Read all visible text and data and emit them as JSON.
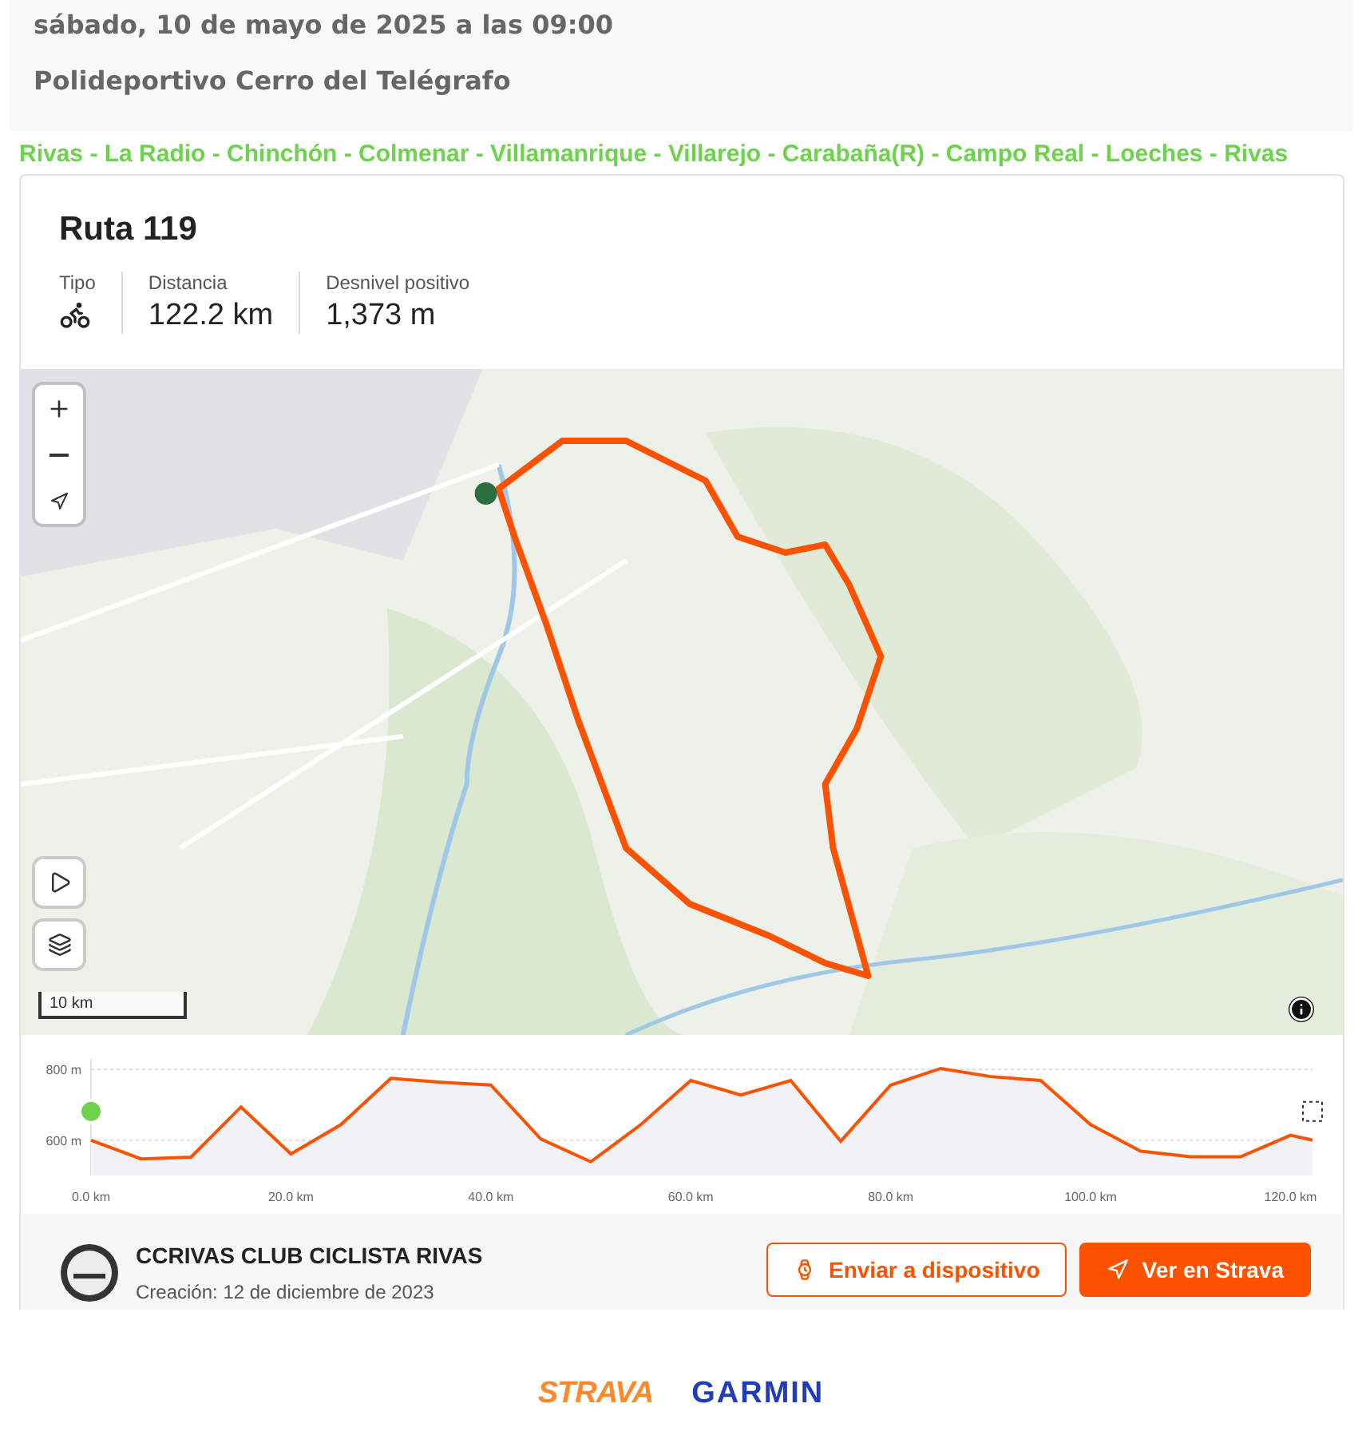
{
  "event": {
    "date": "sábado, 10 de mayo de 2025 a las 09:00",
    "place": "Polideportivo Cerro del Telégrafo"
  },
  "route_line": "Rivas - La Radio - Chinchón - Colmenar - Villamanrique - Villarejo - Carabaña(R) - Campo Real - Loeches - Rivas",
  "route": {
    "title": "Ruta 119",
    "stats": [
      {
        "kind": "icon",
        "label": "Tipo"
      },
      {
        "kind": "text",
        "label": "Distancia",
        "value": "122.2 km"
      },
      {
        "kind": "text",
        "label": "Desnivel positivo",
        "value": "1,373 m"
      }
    ]
  },
  "map": {
    "kind": "picture",
    "scale": "10 km"
  },
  "elevation": {
    "chart_data": {
      "type": "area",
      "x": [
        0,
        5,
        10,
        15,
        20,
        25,
        30,
        35,
        40,
        45,
        50,
        55,
        60,
        65,
        70,
        75,
        80,
        85,
        90,
        95,
        100,
        105,
        110,
        115,
        120,
        122.2
      ],
      "series": [
        {
          "color": "#fc5200",
          "values": [
            600,
            547,
            552,
            694,
            561,
            644,
            775,
            764,
            756,
            603,
            539,
            644,
            769,
            728,
            769,
            597,
            756,
            803,
            780,
            769,
            644,
            569,
            553,
            553,
            614,
            600
          ]
        }
      ],
      "xlim": [
        0,
        122.2
      ],
      "ylim": [
        500,
        830
      ],
      "xticks": [
        {
          "value": 0,
          "label": "0.0 km"
        },
        {
          "value": 20,
          "label": "20.0 km"
        },
        {
          "value": 40,
          "label": "40.0 km"
        },
        {
          "value": 60,
          "label": "60.0 km"
        },
        {
          "value": 80,
          "label": "80.0 km"
        },
        {
          "value": 100,
          "label": "100.0 km"
        },
        {
          "value": 120,
          "label": "120.0 km"
        }
      ],
      "yticks": [
        {
          "value": 600,
          "label": "600 m"
        },
        {
          "value": 800,
          "label": "800 m"
        }
      ]
    }
  },
  "footer": {
    "club": "CCRIVAS CLUB CICLISTA RIVAS",
    "created": "Creación: 12 de diciembre de 2023",
    "buttons": [
      {
        "kind": "outline",
        "label": "Enviar a dispositivo"
      },
      {
        "kind": "filled",
        "label": "Ver en Strava"
      }
    ]
  },
  "partners": [
    {
      "kind": "strava",
      "label": "STRAVA"
    },
    {
      "kind": "garmin",
      "label": "GARMIN"
    }
  ]
}
